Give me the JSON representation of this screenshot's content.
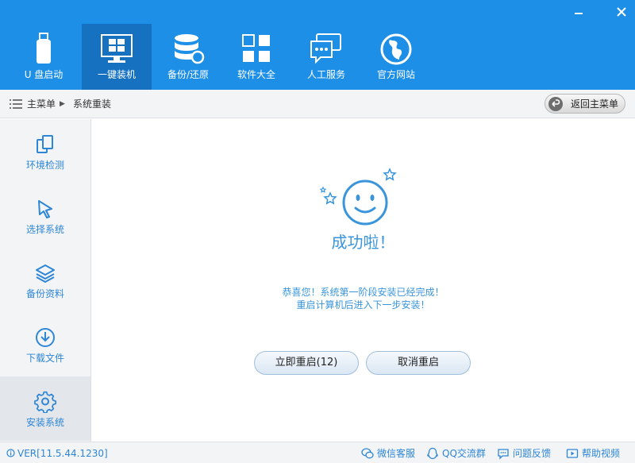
{
  "window": {
    "minimize_icon": "minimize-icon",
    "close_icon": "close-icon"
  },
  "nav": {
    "items": [
      {
        "label": "U 盘启动",
        "icon": "usb-drive-icon"
      },
      {
        "label": "一键装机",
        "icon": "windows-monitor-icon",
        "active": true
      },
      {
        "label": "备份/还原",
        "icon": "database-restore-icon"
      },
      {
        "label": "软件大全",
        "icon": "apps-grid-icon"
      },
      {
        "label": "人工服务",
        "icon": "chat-bubbles-icon"
      },
      {
        "label": "官方网站",
        "icon": "globe-icon"
      }
    ]
  },
  "breadcrumb": {
    "home": "主菜单",
    "current": "系统重装",
    "back_label": "返回主菜单"
  },
  "sidebar": {
    "items": [
      {
        "label": "环境检测",
        "icon": "copy-devices-icon"
      },
      {
        "label": "选择系统",
        "icon": "cursor-arrow-icon"
      },
      {
        "label": "备份资料",
        "icon": "layers-icon"
      },
      {
        "label": "下载文件",
        "icon": "download-circle-icon"
      },
      {
        "label": "安装系统",
        "icon": "gear-icon",
        "active": true
      }
    ]
  },
  "main": {
    "title": "成功啦！",
    "message_line1": "恭喜您！系统第一阶段安装已经完成！",
    "message_line2": "重启计算机后进入下一步安装！",
    "restart_label": "立即重启(12)",
    "cancel_label": "取消重启"
  },
  "footer": {
    "version": "VER[11.5.44.1230]",
    "links": [
      {
        "label": "微信客服",
        "icon": "wechat-icon"
      },
      {
        "label": "QQ交流群",
        "icon": "qq-icon"
      },
      {
        "label": "问题反馈",
        "icon": "feedback-icon"
      },
      {
        "label": "帮助视频",
        "icon": "video-icon"
      }
    ]
  },
  "colors": {
    "topbar": "#1e8fe6",
    "accent": "#3a95db",
    "panel": "#f2f4f6"
  }
}
